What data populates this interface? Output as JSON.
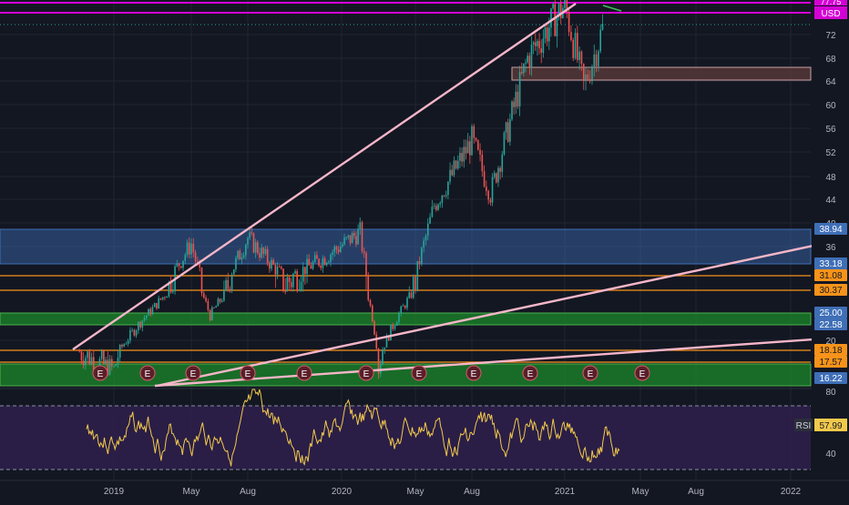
{
  "currency": "USD",
  "price_scale": {
    "ticks": [
      "72",
      "68",
      "64",
      "60",
      "56",
      "52",
      "48",
      "44",
      "40",
      "36",
      "20"
    ],
    "price_ticks_values": [
      72,
      68,
      64,
      60,
      56,
      52,
      48,
      44,
      40,
      36,
      20
    ],
    "top_partial_label": "77.75",
    "horizontal_level_labels": [
      {
        "text": "38.94",
        "bg": "#3f6fb7",
        "fg": "#ffffff"
      },
      {
        "text": "33.18",
        "bg": "#3f6fb7",
        "fg": "#ffffff"
      },
      {
        "text": "31.08",
        "bg": "#f7931a",
        "fg": "#131722"
      },
      {
        "text": "30.37",
        "bg": "#f7931a",
        "fg": "#131722"
      },
      {
        "text": "25.00",
        "bg": "#3f6fb7",
        "fg": "#ffffff"
      },
      {
        "text": "22.58",
        "bg": "#3f6fb7",
        "fg": "#ffffff"
      },
      {
        "text": "18.18",
        "bg": "#f7931a",
        "fg": "#131722"
      },
      {
        "text": "17.57",
        "bg": "#f7931a",
        "fg": "#131722"
      },
      {
        "text": "16.22",
        "bg": "#3f6fb7",
        "fg": "#ffffff"
      }
    ]
  },
  "rsi": {
    "label": "RSI",
    "value": "57.99",
    "ticks": [
      "80",
      "40"
    ]
  },
  "time_axis": {
    "labels": [
      "2019",
      "May",
      "Aug",
      "2020",
      "May",
      "Aug",
      "2021",
      "May",
      "Aug",
      "2022"
    ]
  },
  "earnings_marker": "E",
  "earnings_count": 11,
  "colors": {
    "background": "#131722",
    "grid": "#1f2433",
    "up": "#26a69a",
    "down": "#ef5350",
    "trendline": "#f6b6c8",
    "blue_zone": "#3f6fb7",
    "green_zone": "#1b8a2a",
    "orange_line": "#f7931a",
    "magenta": "#d500d5",
    "rsi_line": "#f2c94c",
    "rsi_bg": "#2d1f4a",
    "brown_zone": "#5a3a3a"
  },
  "chart_data": {
    "type": "candlestick",
    "title": "",
    "price_path_approx": [
      {
        "t": "2018-11",
        "close": 18.2
      },
      {
        "t": "2019-01",
        "close": 17.0
      },
      {
        "t": "2019-03",
        "close": 26.0
      },
      {
        "t": "2019-05",
        "close": 36.5
      },
      {
        "t": "2019-06",
        "close": 24.5
      },
      {
        "t": "2019-08",
        "close": 37.5
      },
      {
        "t": "2019-10",
        "close": 30.5
      },
      {
        "t": "2019-12",
        "close": 34.0
      },
      {
        "t": "2020-02",
        "close": 38.5
      },
      {
        "t": "2020-03",
        "close": 17.0
      },
      {
        "t": "2020-05",
        "close": 31.0
      },
      {
        "t": "2020-06",
        "close": 43.0
      },
      {
        "t": "2020-08",
        "close": 54.0
      },
      {
        "t": "2020-09",
        "close": 45.0
      },
      {
        "t": "2020-11",
        "close": 68.0
      },
      {
        "t": "2021-01",
        "close": 77.5
      },
      {
        "t": "2021-02",
        "close": 63.0
      },
      {
        "t": "2021-03",
        "close": 73.0
      }
    ],
    "zones": [
      {
        "name": "blue",
        "from": 33.18,
        "to": 38.94
      },
      {
        "name": "green",
        "from": 22.58,
        "to": 25.0
      },
      {
        "name": "green",
        "from": 16.22,
        "to": 17.57
      }
    ],
    "ylim": [
      14.5,
      78.5
    ]
  }
}
